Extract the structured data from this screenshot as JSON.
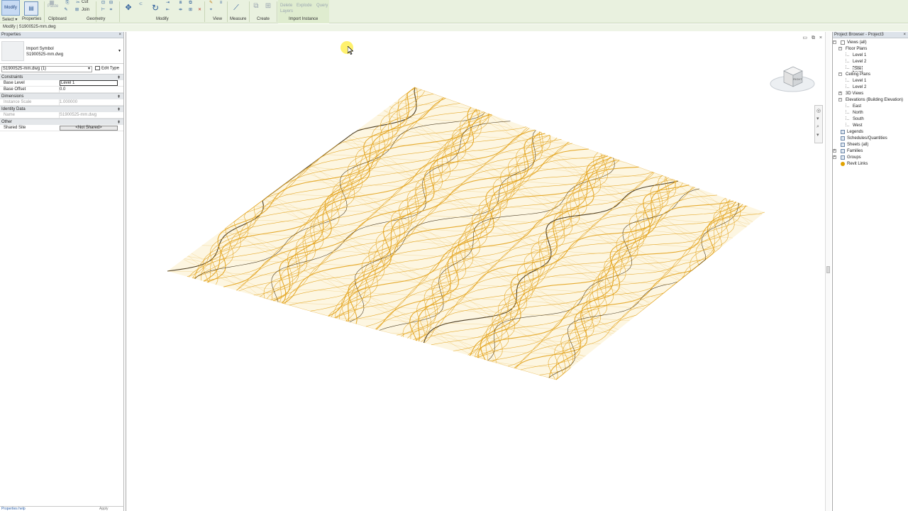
{
  "ribbon": {
    "modify_label": "Modify",
    "select_label": "Select ▾",
    "properties_label": "Properties",
    "paste_label": "Paste",
    "cut_label": "Cut",
    "join_label": "Join",
    "groups": [
      "Clipboard",
      "Geometry",
      "Modify",
      "View",
      "Measure",
      "Create",
      "Import Instance"
    ],
    "import_instance": {
      "delete_layers_line1": "Delete",
      "delete_layers_line2": "Layers",
      "explode_label": "Explode",
      "query_label": "Query"
    }
  },
  "options_bar": {
    "context": "Modify | S1900525-mm.dwg"
  },
  "properties": {
    "title": "Properties",
    "close": "×",
    "type_family": "Import Symbol",
    "type_name": "S1900525-mm.dwg",
    "instance_selector": "S1900525-mm.dwg (1)",
    "edit_type": "Edit Type",
    "sections": {
      "constraints": "Constraints",
      "dimensions": "Dimensions",
      "identity": "Identity Data",
      "other": "Other"
    },
    "rows": {
      "base_level_key": "Base Level",
      "base_level_val": "Level 1",
      "base_offset_key": "Base Offset",
      "base_offset_val": "0.0",
      "instance_scale_key": "Instance Scale",
      "instance_scale_val": "1.000000",
      "name_key": "Name",
      "name_val": "S1900525-mm.dwg",
      "shared_site_key": "Shared Site",
      "shared_site_val": "<Not Shared>"
    },
    "properties_help": "Properties help",
    "apply": "Apply"
  },
  "canvas": {
    "view_controls": "▭ ⧉ ×",
    "viewcube_face": "RIGHT",
    "terrain_color": "#e3a31c",
    "contour_dark": "#3a2a10"
  },
  "project_browser": {
    "title": "Project Browser - Project3",
    "close": "×",
    "tree": [
      {
        "label": "Views (all)",
        "level": 0,
        "exp": "−"
      },
      {
        "label": "Floor Plans",
        "level": 1,
        "exp": "−"
      },
      {
        "label": "Level 1",
        "level": 2
      },
      {
        "label": "Level 2",
        "level": 2
      },
      {
        "label": "Site",
        "level": 2,
        "selected": true
      },
      {
        "label": "Ceiling Plans",
        "level": 1,
        "exp": "−"
      },
      {
        "label": "Level 1",
        "level": 2
      },
      {
        "label": "Level 2",
        "level": 2
      },
      {
        "label": "3D Views",
        "level": 1,
        "exp": "+"
      },
      {
        "label": "Elevations (Building Elevation)",
        "level": 1,
        "exp": "−"
      },
      {
        "label": "East",
        "level": 2
      },
      {
        "label": "North",
        "level": 2
      },
      {
        "label": "South",
        "level": 2
      },
      {
        "label": "West",
        "level": 2
      },
      {
        "label": "Legends",
        "level": 0,
        "icon": true
      },
      {
        "label": "Schedules/Quantities",
        "level": 0,
        "icon": true
      },
      {
        "label": "Sheets (all)",
        "level": 0,
        "icon": true
      },
      {
        "label": "Families",
        "level": 0,
        "exp": "+",
        "icon": true
      },
      {
        "label": "Groups",
        "level": 0,
        "exp": "+",
        "icon": true
      },
      {
        "label": "Revit Links",
        "level": 0,
        "icon": true,
        "link": true
      }
    ]
  }
}
